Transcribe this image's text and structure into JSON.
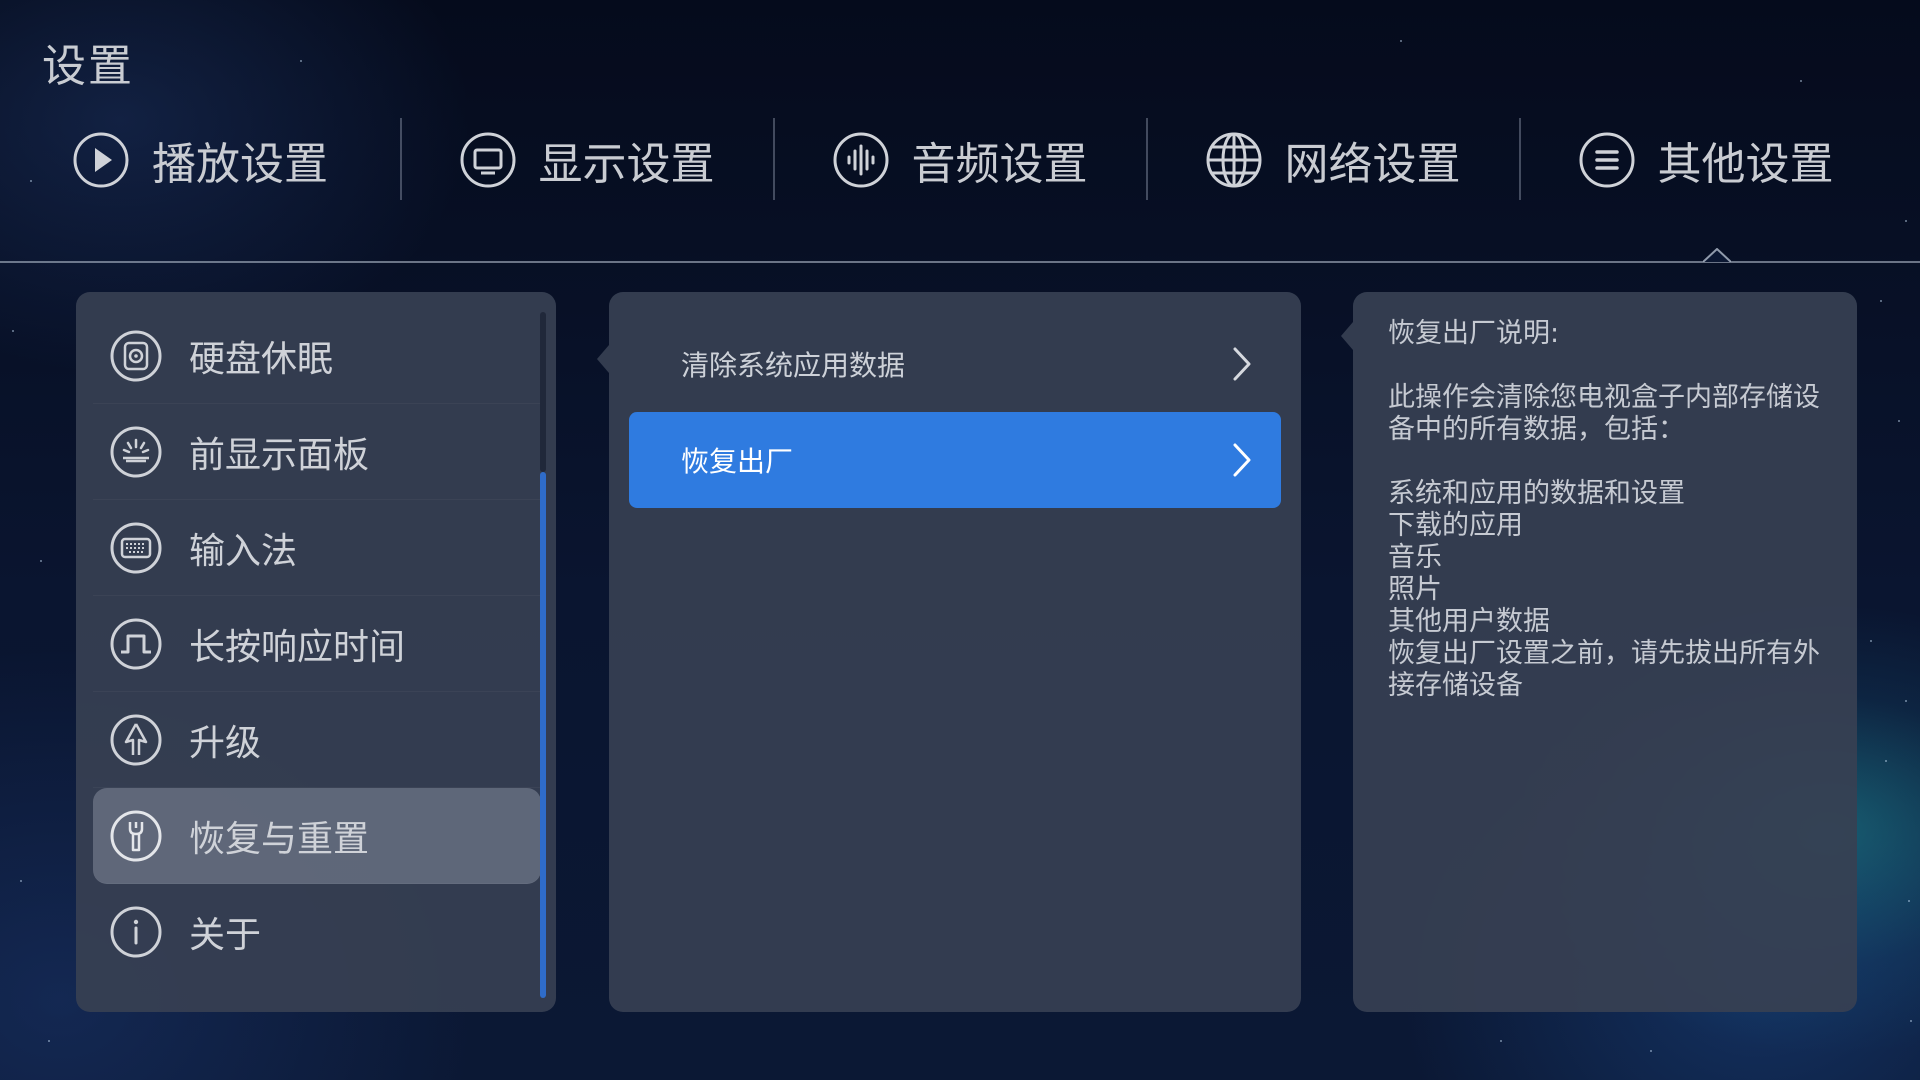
{
  "screen": {
    "title": "设置"
  },
  "top_tabs": [
    {
      "label": "播放设置",
      "icon": "play-icon"
    },
    {
      "label": "显示设置",
      "icon": "display-icon"
    },
    {
      "label": "音频设置",
      "icon": "audio-icon"
    },
    {
      "label": "网络设置",
      "icon": "globe-icon"
    },
    {
      "label": "其他设置",
      "icon": "menu-icon",
      "selected": true
    }
  ],
  "sidebar": {
    "items": [
      {
        "label": "硬盘休眠",
        "icon": "harddisk-icon"
      },
      {
        "label": "前显示面板",
        "icon": "front-panel-icon"
      },
      {
        "label": "输入法",
        "icon": "keyboard-icon"
      },
      {
        "label": "长按响应时间",
        "icon": "pulse-icon"
      },
      {
        "label": "升级",
        "icon": "upgrade-icon"
      },
      {
        "label": "恢复与重置",
        "icon": "wrench-icon",
        "selected": true
      },
      {
        "label": "关于",
        "icon": "info-icon"
      }
    ]
  },
  "options": [
    {
      "label": "清除系统应用数据",
      "active": false
    },
    {
      "label": "恢复出厂",
      "active": true
    }
  ],
  "description": {
    "heading": "恢复出厂说明:",
    "intro": "此操作会清除您电视盒子内部存储设备中的所有数据，包括：",
    "items": [
      "系统和应用的数据和设置",
      "下载的应用",
      "音乐",
      "照片",
      "其他用户数据"
    ],
    "note": "恢复出厂设置之前，请先拔出所有外接存储设备"
  },
  "colors": {
    "accent": "#2f7be0",
    "panel": "#374052",
    "selected_item": "#6e7687",
    "background": "#0a1530"
  }
}
